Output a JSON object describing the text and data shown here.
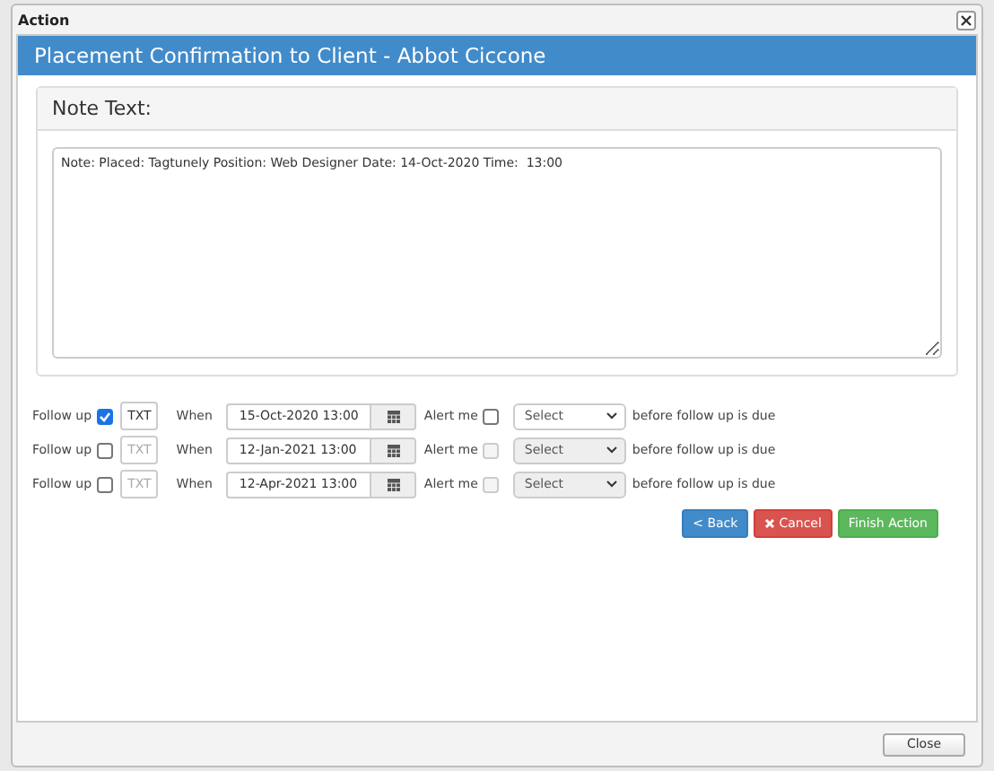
{
  "window": {
    "title": "Action"
  },
  "header": {
    "title": "Placement Confirmation to Client - Abbot Ciccone"
  },
  "note": {
    "heading": "Note Text:",
    "value": "Note: Placed: Tagtunely Position: Web Designer Date: 14-Oct-2020 Time:  13:00"
  },
  "follow_ups": [
    {
      "label": "Follow up",
      "checked": true,
      "txt": "TXT",
      "when_label": "When",
      "date": "15-Oct-2020 13:00",
      "alert_label": "Alert me",
      "alert_checked": false,
      "alert_disabled": false,
      "select": "Select",
      "suffix": "before follow up is due"
    },
    {
      "label": "Follow up",
      "checked": false,
      "txt": "TXT",
      "when_label": "When",
      "date": "12-Jan-2021 13:00",
      "alert_label": "Alert me",
      "alert_checked": false,
      "alert_disabled": true,
      "select": "Select",
      "suffix": "before follow up is due"
    },
    {
      "label": "Follow up",
      "checked": false,
      "txt": "TXT",
      "when_label": "When",
      "date": "12-Apr-2021 13:00",
      "alert_label": "Alert me",
      "alert_checked": false,
      "alert_disabled": true,
      "select": "Select",
      "suffix": "before follow up is due"
    }
  ],
  "actions": [
    {
      "label": "< Back",
      "kind": "back"
    },
    {
      "label": "Cancel",
      "kind": "cancel"
    },
    {
      "label": "Finish Action",
      "kind": "finish"
    }
  ],
  "footer": {
    "close": "Close"
  }
}
